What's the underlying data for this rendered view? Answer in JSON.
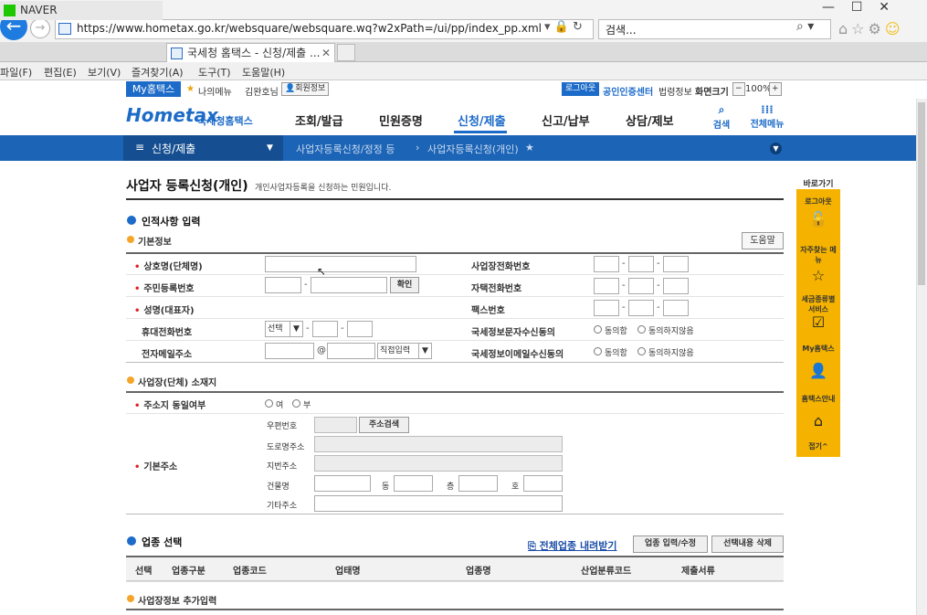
{
  "browser": {
    "url": "https://www.hometax.go.kr/websquare/websquare.wq?w2xPath=/ui/pp/index_pp.xml",
    "search_placeholder": "검색...",
    "tabs": [
      {
        "label": "NAVER"
      },
      {
        "label": "국세청 홈택스 - 신청/제출 ..."
      }
    ],
    "menu": [
      "파일(F)",
      "편집(E)",
      "보기(V)",
      "즐겨찾기(A)",
      "도구(T)",
      "도움말(H)"
    ]
  },
  "util": {
    "my_hometax": "My홈택스",
    "my_menu": "나의메뉴",
    "user": "김완호님",
    "member_info": "회원정보",
    "logout": "로그아웃",
    "cert_center": "공인인증센터",
    "law_info": "법령정보",
    "screen_size": "화면크기",
    "zoom": "100%"
  },
  "header": {
    "logo": "Hometax",
    "logo_sub": "국세청홈택스",
    "nav": [
      "조회/발급",
      "민원증명",
      "신청/제출",
      "신고/납부",
      "상담/제보"
    ],
    "search": "검색",
    "all_menu": "전체메뉴"
  },
  "breadcrumb": {
    "menu": "신청/제출",
    "level2": "사업자등록신청/정정 등",
    "level3": "사업자등록신청(개인)"
  },
  "page": {
    "title": "사업자 등록신청(개인)",
    "desc": "개인사업자등록을 신청하는 민원입니다.",
    "help": "도움말"
  },
  "section1": {
    "title": "인적사항 입력",
    "sub": "기본정보",
    "left_labels": [
      "상호명(단체명)",
      "주민등록번호",
      "성명(대표자)",
      "휴대전화번호",
      "전자메일주소"
    ],
    "right_labels": [
      "사업장전화번호",
      "자택전화번호",
      "팩스번호",
      "국세정보문자수신동의",
      "국세정보이메일수신동의"
    ],
    "confirm_btn": "확인",
    "phone_select": "선택",
    "email_at": "@",
    "email_select": "직접입력",
    "agree": "동의함",
    "disagree": "동의하지않음"
  },
  "section2": {
    "sub": "사업장(단체) 소재지",
    "same_label": "주소지 동일여부",
    "yes": "여",
    "no": "부",
    "addr_label": "기본주소",
    "zip": "우편번호",
    "search_addr": "주소검색",
    "road": "도로명주소",
    "lot": "지번주소",
    "building": "건물명",
    "dong": "동",
    "floor": "층",
    "ho": "호",
    "etc": "기타주소"
  },
  "section3": {
    "title": "업종 선택",
    "download": "전체업종 내려받기",
    "edit": "업종 입력/수정",
    "delete": "선택내용 삭제",
    "columns": [
      "선택",
      "업종구분",
      "업종코드",
      "업태명",
      "업종명",
      "산업분류코드",
      "제출서류"
    ]
  },
  "section4": {
    "sub": "사업장정보 추가입력"
  },
  "quick": {
    "title": "바로가기",
    "items": [
      "로그아웃",
      "자주찾는 메뉴",
      "세금종류별 서비스",
      "My홈택스",
      "홈택스안내"
    ],
    "fold": "접기"
  }
}
